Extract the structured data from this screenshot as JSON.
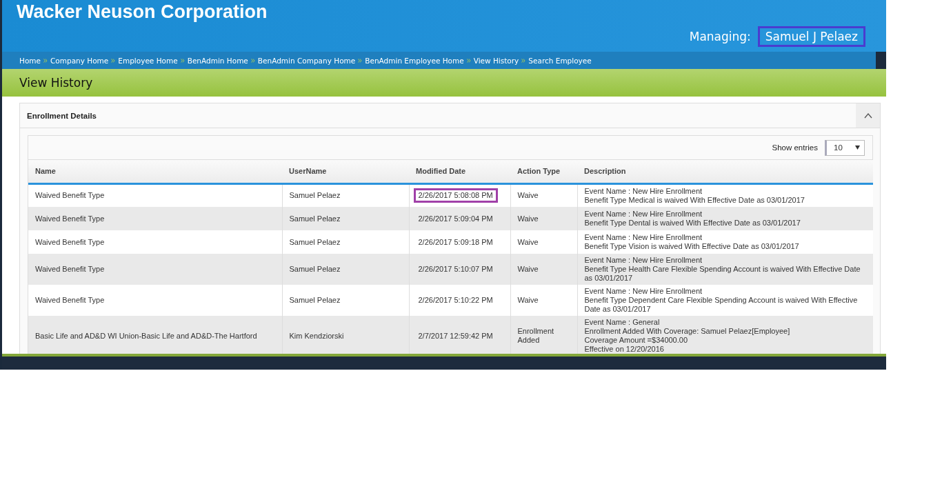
{
  "header": {
    "company": "Wacker Neuson Corporation",
    "managing_label": "Managing:",
    "managing_name": "Samuel J Pelaez",
    "managing_highlighted": true
  },
  "breadcrumbs": [
    "Home",
    "Company Home",
    "Employee Home",
    "BenAdmin Home",
    "BenAdmin Company Home",
    "BenAdmin Employee Home",
    "View History",
    "Search Employee"
  ],
  "page_title": "View History",
  "panel": {
    "title": "Enrollment Details",
    "expanded": true
  },
  "table": {
    "show_entries_label": "Show entries",
    "page_size": "10",
    "columns": [
      "Name",
      "UserName",
      "Modified Date",
      "Action Type",
      "Description"
    ],
    "rows": [
      {
        "name": "Waived Benefit Type",
        "user": "Samuel Pelaez",
        "date": "2/26/2017 5:08:08 PM",
        "date_highlighted": true,
        "action": "Waive",
        "description": [
          "Event Name : New Hire Enrollment",
          "Benefit Type Medical is waived With Effective Date as 03/01/2017"
        ]
      },
      {
        "name": "Waived Benefit Type",
        "user": "Samuel Pelaez",
        "date": "2/26/2017 5:09:04 PM",
        "date_highlighted": false,
        "action": "Waive",
        "description": [
          "Event Name : New Hire Enrollment",
          "Benefit Type Dental is waived With Effective Date as 03/01/2017"
        ]
      },
      {
        "name": "Waived Benefit Type",
        "user": "Samuel Pelaez",
        "date": "2/26/2017 5:09:18 PM",
        "date_highlighted": false,
        "action": "Waive",
        "description": [
          "Event Name : New Hire Enrollment",
          "Benefit Type Vision is waived With Effective Date as 03/01/2017"
        ]
      },
      {
        "name": "Waived Benefit Type",
        "user": "Samuel Pelaez",
        "date": "2/26/2017 5:10:07 PM",
        "date_highlighted": false,
        "action": "Waive",
        "description": [
          "Event Name : New Hire Enrollment",
          "Benefit Type Health Care Flexible Spending Account is waived With Effective Date as 03/01/2017"
        ]
      },
      {
        "name": "Waived Benefit Type",
        "user": "Samuel Pelaez",
        "date": "2/26/2017 5:10:22 PM",
        "date_highlighted": false,
        "action": "Waive",
        "description": [
          "Event Name : New Hire Enrollment",
          "Benefit Type Dependent Care Flexible Spending Account is waived With Effective Date as 03/01/2017"
        ]
      },
      {
        "name": "Basic Life and AD&D WI Union-Basic Life and AD&D-The Hartford",
        "user": "Kim Kendziorski",
        "date": "2/7/2017 12:59:42 PM",
        "date_highlighted": false,
        "action": "Enrollment Added",
        "description": [
          "Event Name : General",
          "Enrollment Added With Coverage: Samuel Pelaez[Employee]",
          "Coverage Amount =$34000.00",
          "Effective on 12/20/2016"
        ]
      }
    ]
  }
}
